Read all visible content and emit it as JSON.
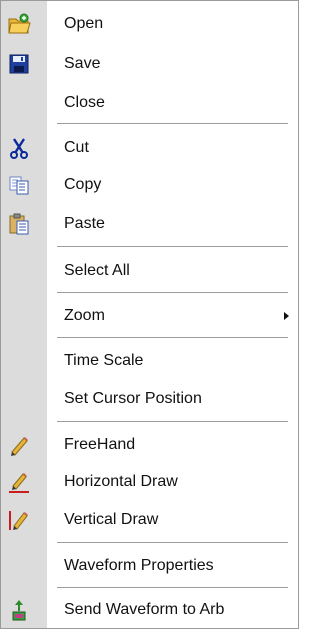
{
  "menu": {
    "open": "Open",
    "save": "Save",
    "close": "Close",
    "cut": "Cut",
    "copy": "Copy",
    "paste": "Paste",
    "select_all": "Select All",
    "zoom": "Zoom",
    "time_scale": "Time Scale",
    "set_cursor_position": "Set Cursor Position",
    "freehand": "FreeHand",
    "horizontal_draw": "Horizontal Draw",
    "vertical_draw": "Vertical Draw",
    "waveform_properties": "Waveform Properties",
    "send_waveform_to_arb": "Send Waveform to Arb"
  },
  "icons": {
    "open": "open-folder-icon",
    "save": "floppy-disk-icon",
    "cut": "scissors-icon",
    "copy": "copy-icon",
    "paste": "clipboard-icon",
    "freehand": "pencil-icon",
    "horizontal_draw": "horizontal-pencil-icon",
    "vertical_draw": "vertical-pencil-icon",
    "send_waveform_to_arb": "send-to-device-icon",
    "zoom_submenu": "submenu-arrow-icon"
  },
  "colors": {
    "gutter": "#dcdcdc",
    "separator": "#9c9c9c",
    "text": "#111111",
    "border": "#9a9a9a"
  }
}
